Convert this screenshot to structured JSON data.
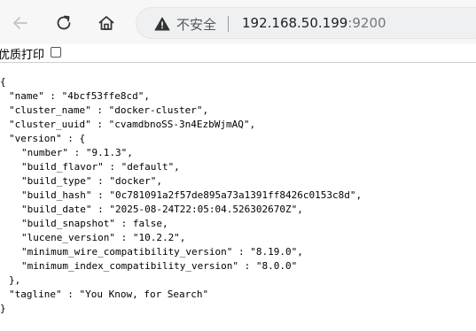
{
  "browser": {
    "back_icon": "arrow-left-icon",
    "reload_icon": "reload-icon",
    "home_icon": "home-icon",
    "security_label": "不安全",
    "url_host": "192.168.50.199",
    "url_port": ":9200"
  },
  "print_option": {
    "label": "优质打印",
    "checked": false
  },
  "json_lines": [
    "{",
    "\"name\" : \"4bcf53ffe8cd\",",
    "\"cluster_name\" : \"docker-cluster\",",
    "\"cluster_uuid\" : \"cvamdbnoSS-3n4EzbWjmAQ\",",
    "\"version\" : {",
    "\"number\" : \"9.1.3\",",
    "\"build_flavor\" : \"default\",",
    "\"build_type\" : \"docker\",",
    "\"build_hash\" : \"0c781091a2f57de895a73a1391ff8426c0153c8d\",",
    "\"build_date\" : \"2025-08-24T22:05:04.526302670Z\",",
    "\"build_snapshot\" : false,",
    "\"lucene_version\" : \"10.2.2\",",
    "\"minimum_wire_compatibility_version\" : \"8.19.0\",",
    "\"minimum_index_compatibility_version\" : \"8.0.0\"",
    "},",
    "\"tagline\" : \"You Know, for Search\"",
    "}"
  ]
}
